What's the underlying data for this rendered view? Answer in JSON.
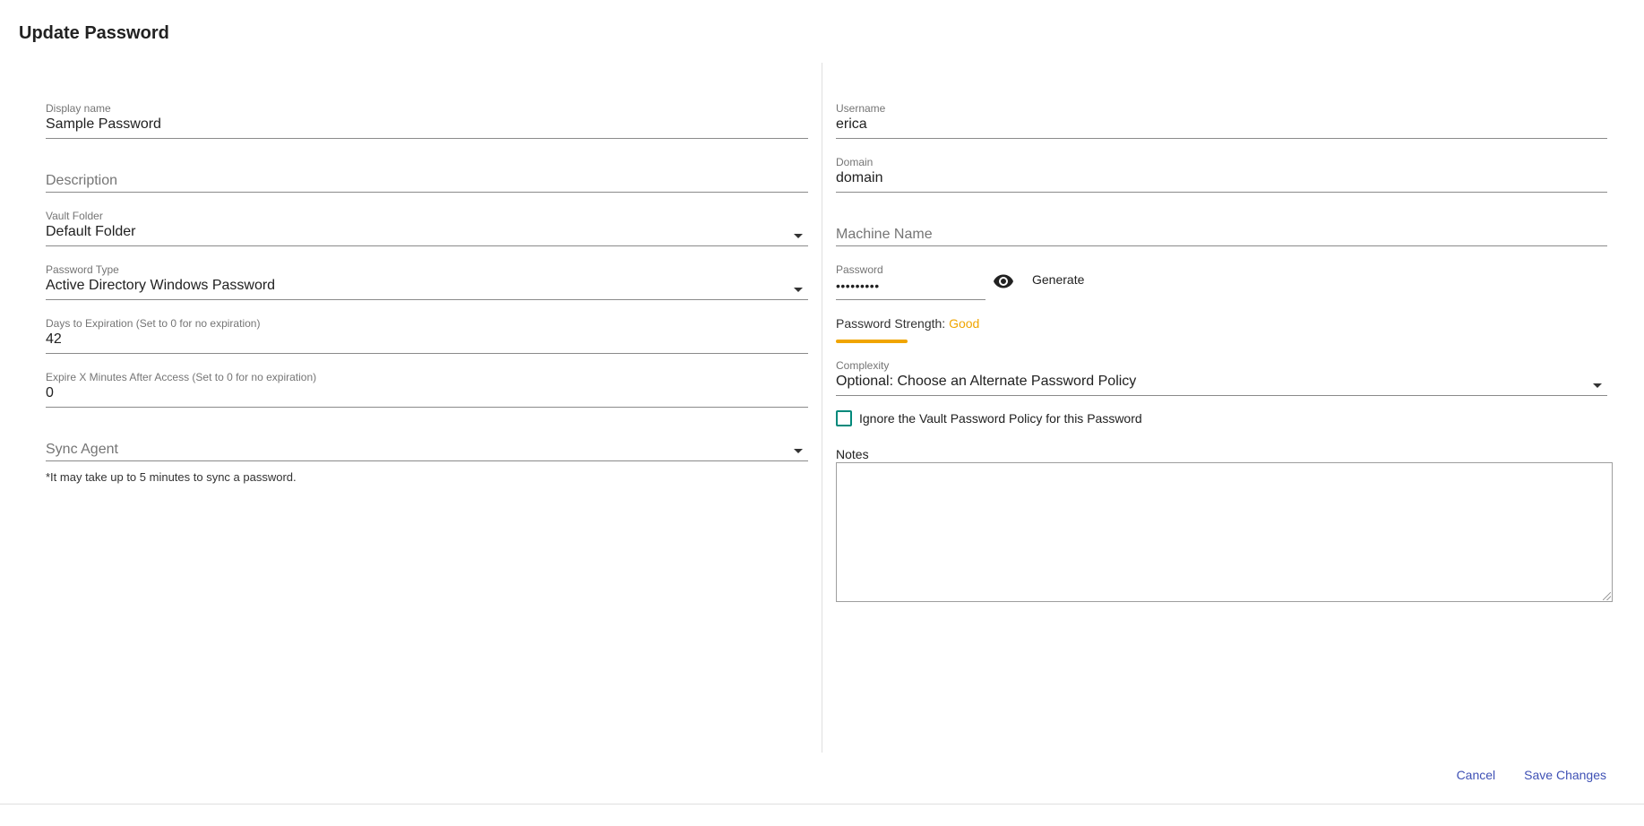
{
  "dialog": {
    "title": "Update Password"
  },
  "left": {
    "display_name": {
      "label": "Display name",
      "value": "Sample Password"
    },
    "description": {
      "placeholder": "Description"
    },
    "vault_folder": {
      "label": "Vault Folder",
      "value": "Default Folder"
    },
    "password_type": {
      "label": "Password Type",
      "value": "Active Directory Windows Password"
    },
    "days_to_expiration": {
      "label": "Days to Expiration (Set to 0 for no expiration)",
      "value": "42"
    },
    "expire_minutes": {
      "label": "Expire X Minutes After Access (Set to 0 for no expiration)",
      "value": "0"
    },
    "sync_agent": {
      "placeholder": "Sync Agent"
    },
    "sync_note": "*It may take up to 5 minutes to sync a password."
  },
  "right": {
    "username": {
      "label": "Username",
      "value": "erica"
    },
    "domain": {
      "label": "Domain",
      "value": "domain"
    },
    "machine_name": {
      "placeholder": "Machine Name"
    },
    "password": {
      "label": "Password",
      "value": "•••••••••"
    },
    "generate_label": "Generate",
    "strength": {
      "label": "Password Strength:",
      "value": "Good"
    },
    "complexity": {
      "label": "Complexity",
      "value": "Optional: Choose an Alternate Password Policy"
    },
    "ignore_policy_label": "Ignore the Vault Password Policy for this Password",
    "notes_label": "Notes"
  },
  "actions": {
    "cancel": "Cancel",
    "save": "Save Changes"
  },
  "icons": {
    "visibility": "eye-icon",
    "dropdown": "chevron-down-icon"
  },
  "colors": {
    "accent": "#3f51b5",
    "strength_good": "#f0a500",
    "checkbox": "#00897b"
  }
}
